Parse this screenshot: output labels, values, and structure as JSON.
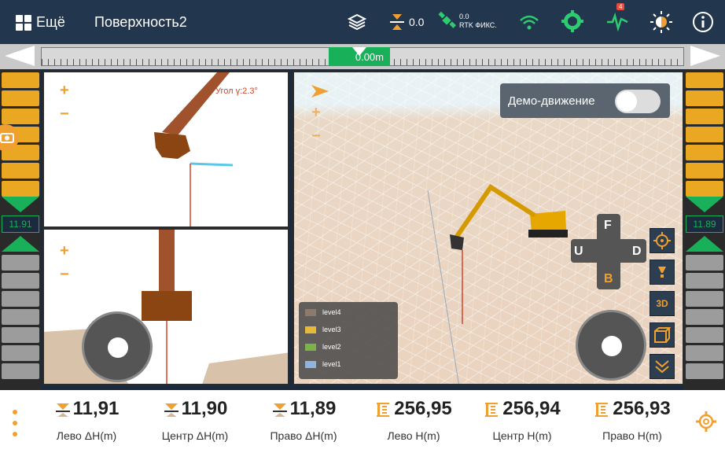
{
  "topbar": {
    "more_label": "Ещё",
    "surface_title": "Поверхность2",
    "elevation_offset": "0.0",
    "rtk_value": "0.0",
    "rtk_status": "RTK ФИКС.",
    "alert_badge": "4"
  },
  "ruler": {
    "offset_label": "0.00m"
  },
  "side": {
    "left_value": "11.91",
    "right_value": "11.89"
  },
  "side_view": {
    "angle_label": "Угол γ:2.3°",
    "zoom_in": "+",
    "zoom_out": "−"
  },
  "front_view": {
    "zoom_in": "+",
    "zoom_out": "−"
  },
  "scene": {
    "demo_label": "Демо-движение",
    "demo_enabled": false,
    "dpad": {
      "forward": "F",
      "back": "B",
      "up": "U",
      "down": "D"
    },
    "tools": {
      "view_3d": "3D"
    },
    "legend": [
      {
        "name": "level4",
        "color": "#8c7a6a"
      },
      {
        "name": "level3",
        "color": "#e6b93a"
      },
      {
        "name": "level2",
        "color": "#7bb34a"
      },
      {
        "name": "level1",
        "color": "#8fb5dc"
      }
    ]
  },
  "stats": [
    {
      "value": "11,91",
      "label": "Лево ΔH(m)",
      "icon": "cut-fill-icon"
    },
    {
      "value": "11,90",
      "label": "Центр ΔH(m)",
      "icon": "cut-fill-icon"
    },
    {
      "value": "11,89",
      "label": "Право ΔH(m)",
      "icon": "cut-fill-icon"
    },
    {
      "value": "256,95",
      "label": "Лево H(m)",
      "icon": "height-ruler-icon"
    },
    {
      "value": "256,94",
      "label": "Центр H(m)",
      "icon": "height-ruler-icon"
    },
    {
      "value": "256,93",
      "label": "Право H(m)",
      "icon": "height-ruler-icon"
    }
  ],
  "colors": {
    "accent": "#f0a030",
    "topbar": "#22364d",
    "green": "#19b05a"
  }
}
